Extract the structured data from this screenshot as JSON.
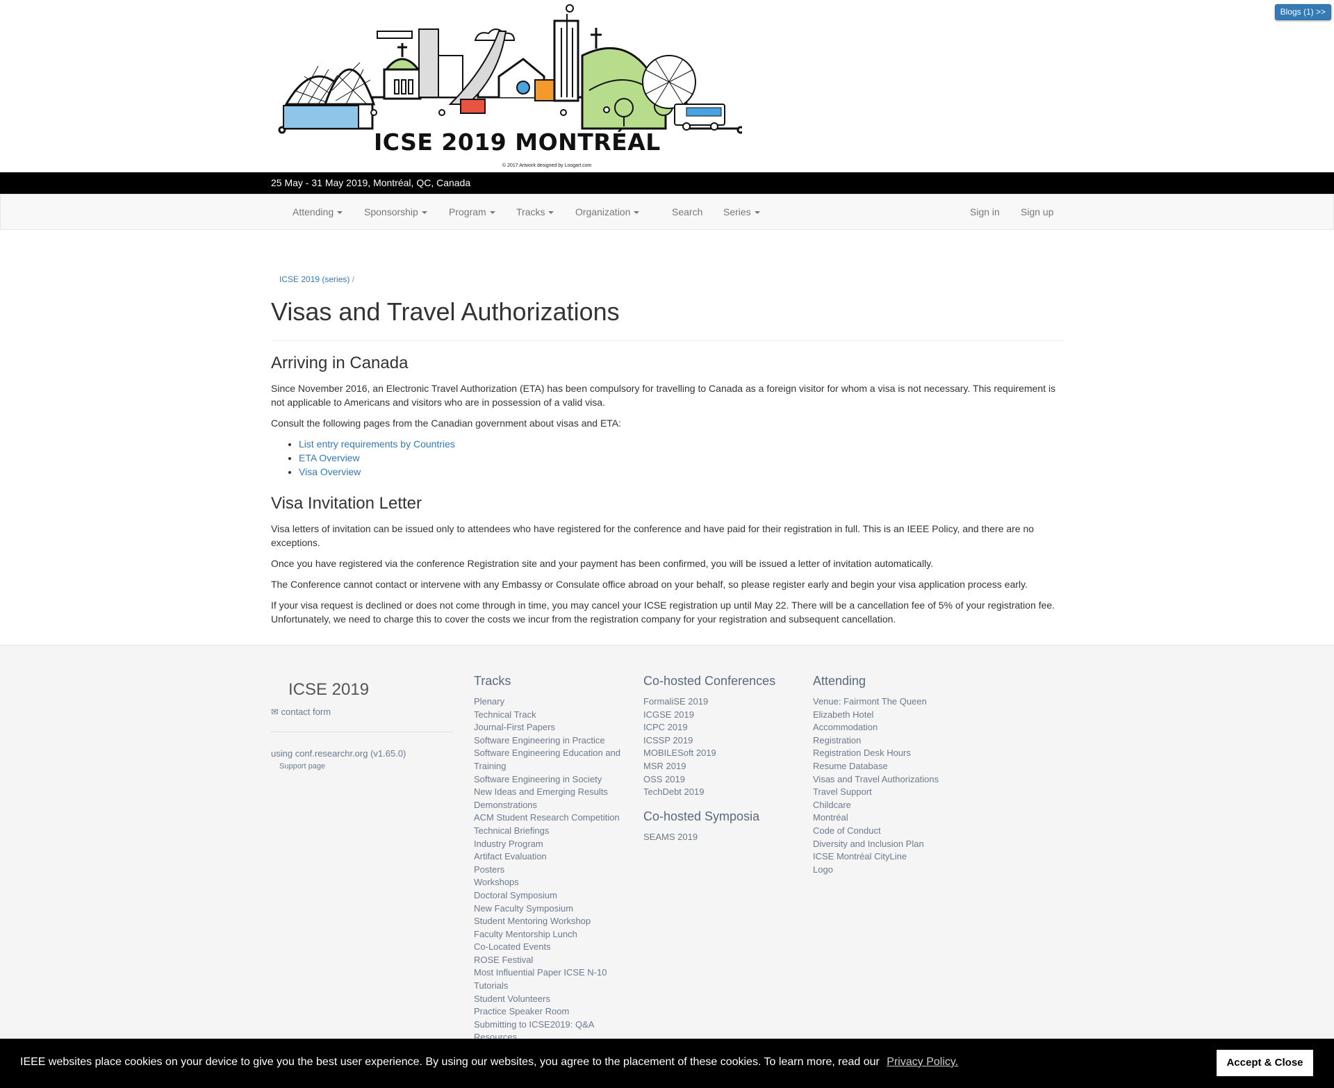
{
  "header": {
    "logo_title": "ICSE 2019 MONTRÉAL",
    "logo_credit": "© 2017 Artwork designed by Loogart.com",
    "blogs_button": "Blogs (1) >>",
    "date_location": "25 May - 31 May 2019, Montréal, QC, Canada"
  },
  "nav": {
    "items": [
      "Attending",
      "Sponsorship",
      "Program",
      "Tracks",
      "Organization",
      "Search",
      "Series"
    ],
    "sign_in": "Sign in",
    "sign_up": "Sign up"
  },
  "breadcrumb": {
    "conf": "ICSE 2019",
    "series": "(series)",
    "sep": "/"
  },
  "page": {
    "title": "Visas and Travel Authorizations",
    "section1": {
      "heading": "Arriving in Canada",
      "p1": "Since November 2016, an Electronic Travel Authorization (ETA) has been compulsory for travelling to Canada as a foreign visitor for whom a visa is not necessary. This requirement is not applicable to Americans and visitors who are in possession of a valid visa.",
      "p2": "Consult the following pages from the Canadian government about visas and ETA:",
      "links": [
        "List entry requirements by Countries",
        "ETA Overview",
        "Visa Overview"
      ]
    },
    "section2": {
      "heading": "Visa Invitation Letter",
      "p1": "Visa letters of invitation can be issued only to attendees who have registered for the conference and have paid for their registration in full. This is an IEEE Policy, and there are no exceptions.",
      "p2": "Once you have registered via the conference Registration site and your payment has been confirmed, you will be issued a letter of invitation automatically.",
      "p3": "The Conference cannot contact or intervene with any Embassy or Consulate office abroad on your behalf, so please register early and begin your visa application process early.",
      "p4": "If your visa request is declined or does not come through in time, you may cancel your ICSE registration up until May 22. There will be a cancellation fee of 5% of your registration fee. Unfortunately, we need to charge this to cover the costs we incur from the registration company for your registration and subsequent cancellation."
    }
  },
  "footer": {
    "brand": "ICSE 2019",
    "contact": "✉ contact form",
    "using": "using conf.researchr.org (v1.65.0)",
    "support": "Support page",
    "tracks": {
      "heading": "Tracks",
      "items": [
        "Plenary",
        "Technical Track",
        "Journal-First Papers",
        "Software Engineering in Practice",
        "Software Engineering Education and Training",
        "Software Engineering in Society",
        "New Ideas and Emerging Results",
        "Demonstrations",
        "ACM Student Research Competition",
        "Technical Briefings",
        "Industry Program",
        "Artifact Evaluation",
        "Posters",
        "Workshops",
        "Doctoral Symposium",
        "New Faculty Symposium",
        "Student Mentoring Workshop",
        "Faculty Mentorship Lunch",
        "Co-Located Events",
        "ROSE Festival",
        "Most Influential Paper ICSE N-10",
        "Tutorials",
        "Student Volunteers",
        "Practice Speaker Room",
        "Submitting to ICSE2019: Q&A",
        "Resources"
      ]
    },
    "cohosted": {
      "heading": "Co-hosted Conferences",
      "items": [
        "FormaliSE 2019",
        "ICGSE 2019",
        "ICPC 2019",
        "ICSSP 2019",
        "MOBILESoft 2019",
        "MSR 2019",
        "OSS 2019",
        "TechDebt 2019"
      ],
      "symposia_heading": "Co-hosted Symposia",
      "symposia_items": [
        "SEAMS 2019"
      ]
    },
    "attending": {
      "heading": "Attending",
      "items": [
        "Venue: Fairmont The Queen Elizabeth Hotel",
        "Accommodation",
        "Registration",
        "Registration Desk Hours",
        "Resume Database",
        "Visas and Travel Authorizations",
        "Travel Support",
        "Childcare",
        "Montréal",
        "Code of Conduct",
        "Diversity and Inclusion Plan",
        "ICSE Montréal CityLine",
        "Logo"
      ]
    }
  },
  "cookie": {
    "message": "IEEE websites place cookies on your device to give you the best user experience. By using our websites, you agree to the placement of these cookies. To learn more, read our",
    "privacy": "Privacy Policy.",
    "accept": "Accept & Close"
  }
}
